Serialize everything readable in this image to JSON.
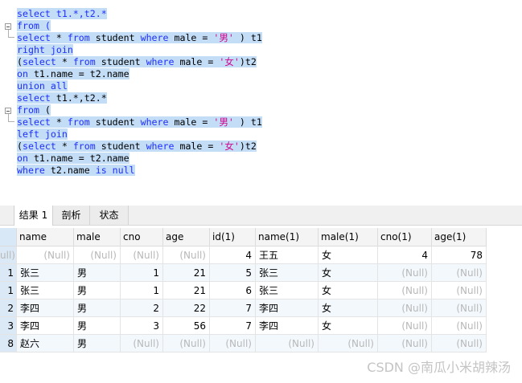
{
  "editor": {
    "lines": [
      [
        {
          "t": "select t1.*,t2.*",
          "c": "kw-mixed"
        }
      ],
      [
        {
          "t": "from (",
          "c": "kw"
        }
      ],
      [
        {
          "t": "select",
          "c": "kw"
        },
        {
          "t": " * ",
          "c": "p"
        },
        {
          "t": "from",
          "c": "kw"
        },
        {
          "t": " student ",
          "c": "p"
        },
        {
          "t": "where",
          "c": "kw"
        },
        {
          "t": " male = ",
          "c": "p"
        },
        {
          "t": "'男'",
          "c": "str"
        },
        {
          "t": " ) t1",
          "c": "p"
        }
      ],
      [
        {
          "t": "right join",
          "c": "kw"
        }
      ],
      [
        {
          "t": "(",
          "c": "p"
        },
        {
          "t": "select",
          "c": "kw"
        },
        {
          "t": " * ",
          "c": "p"
        },
        {
          "t": "from",
          "c": "kw"
        },
        {
          "t": " student ",
          "c": "p"
        },
        {
          "t": "where",
          "c": "kw"
        },
        {
          "t": " male = ",
          "c": "p"
        },
        {
          "t": "'女'",
          "c": "str"
        },
        {
          "t": ")t2",
          "c": "p"
        }
      ],
      [
        {
          "t": "on",
          "c": "kw"
        },
        {
          "t": " t1.name = t2.name",
          "c": "p"
        }
      ],
      [
        {
          "t": "union all",
          "c": "kw"
        }
      ],
      [
        {
          "t": "select",
          "c": "kw"
        },
        {
          "t": " t1.*,t2.*",
          "c": "p"
        }
      ],
      [
        {
          "t": "from",
          "c": "kw"
        },
        {
          "t": " (",
          "c": "p"
        }
      ],
      [
        {
          "t": "select",
          "c": "kw"
        },
        {
          "t": " * ",
          "c": "p"
        },
        {
          "t": "from",
          "c": "kw"
        },
        {
          "t": " student ",
          "c": "p"
        },
        {
          "t": "where",
          "c": "kw"
        },
        {
          "t": " male = ",
          "c": "p"
        },
        {
          "t": "'男'",
          "c": "str"
        },
        {
          "t": " ) t1",
          "c": "p"
        }
      ],
      [
        {
          "t": "left join",
          "c": "kw"
        }
      ],
      [
        {
          "t": "(",
          "c": "p"
        },
        {
          "t": "select",
          "c": "kw"
        },
        {
          "t": " * ",
          "c": "p"
        },
        {
          "t": "from",
          "c": "kw"
        },
        {
          "t": " student ",
          "c": "p"
        },
        {
          "t": "where",
          "c": "kw"
        },
        {
          "t": " male = ",
          "c": "p"
        },
        {
          "t": "'女'",
          "c": "str"
        },
        {
          "t": ")t2",
          "c": "p"
        }
      ],
      [
        {
          "t": "on",
          "c": "kw"
        },
        {
          "t": " t1.name = t2.name",
          "c": "p"
        }
      ],
      [
        {
          "t": "where",
          "c": "kw"
        },
        {
          "t": " t2.name ",
          "c": "p"
        },
        {
          "t": "is null",
          "c": "kw"
        }
      ]
    ]
  },
  "tabs": [
    {
      "label": "结果 1",
      "active": true
    },
    {
      "label": "剖析",
      "active": false
    },
    {
      "label": "状态",
      "active": false
    }
  ],
  "table": {
    "columns": [
      "",
      "name",
      "male",
      "cno",
      "age",
      "id(1)",
      "name(1)",
      "male(1)",
      "cno(1)",
      "age(1)"
    ],
    "rows": [
      [
        "ull)",
        "(Null)",
        "(Null)",
        "(Null)",
        "(Null)",
        "4",
        "王五",
        "女",
        "4",
        "78"
      ],
      [
        "1",
        "张三",
        "男",
        "1",
        "21",
        "5",
        "张三",
        "女",
        "(Null)",
        "(Null)"
      ],
      [
        "1",
        "张三",
        "男",
        "1",
        "21",
        "6",
        "张三",
        "女",
        "(Null)",
        "(Null)"
      ],
      [
        "2",
        "李四",
        "男",
        "2",
        "22",
        "7",
        "李四",
        "女",
        "(Null)",
        "(Null)"
      ],
      [
        "3",
        "李四",
        "男",
        "3",
        "56",
        "7",
        "李四",
        "女",
        "(Null)",
        "(Null)"
      ],
      [
        "8",
        "赵六",
        "男",
        "(Null)",
        "(Null)",
        "(Null)",
        "(Null)",
        "(Null)",
        "(Null)",
        "(Null)"
      ]
    ]
  },
  "watermark": "CSDN @南瓜小米胡辣汤",
  "colors": {
    "keyword": "#1f2fff",
    "string": "#d1008d",
    "selection": "#c3ddf7",
    "null_text": "#b8b8b8"
  }
}
